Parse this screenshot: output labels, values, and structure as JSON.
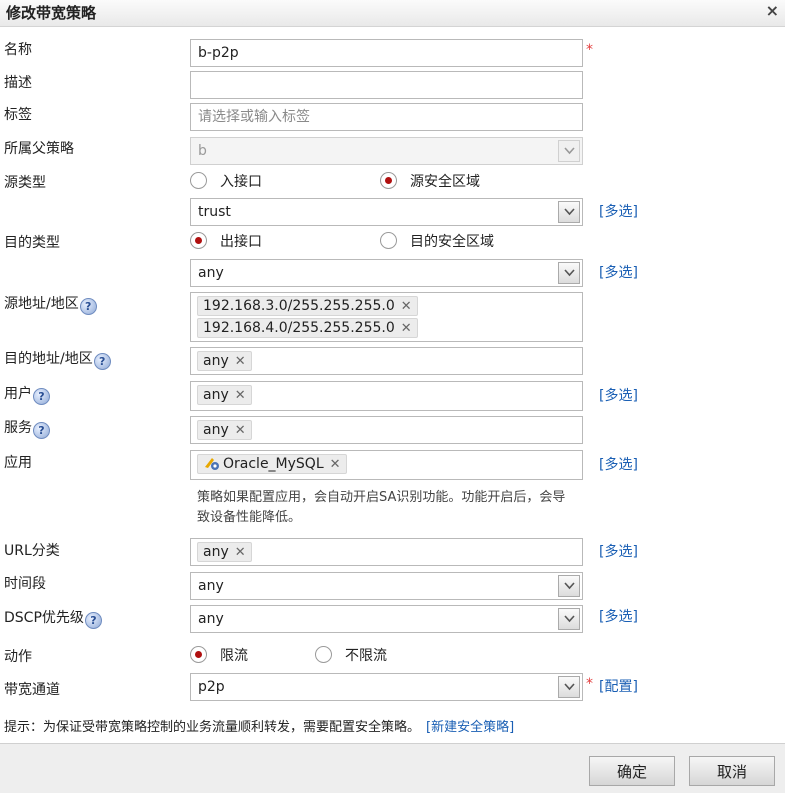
{
  "dialog": {
    "title": "修改带宽策略",
    "close": "×"
  },
  "fields": {
    "name": {
      "label": "名称",
      "value": "b-p2p",
      "required": "*"
    },
    "desc": {
      "label": "描述",
      "value": ""
    },
    "tags": {
      "label": "标签",
      "placeholder": "请选择或输入标签"
    },
    "parent": {
      "label": "所属父策略",
      "value": "b"
    },
    "src_type": {
      "label": "源类型",
      "opt1": "入接口",
      "opt2": "源安全区域",
      "selected": "源安全区域",
      "zone": "trust",
      "multi": "[多选]"
    },
    "dst_type": {
      "label": "目的类型",
      "opt1": "出接口",
      "opt2": "目的安全区域",
      "selected": "出接口",
      "iface": "any",
      "multi": "[多选]"
    },
    "src_addr": {
      "label": "源地址/地区",
      "tags": [
        "192.168.3.0/255.255.255.0",
        "192.168.4.0/255.255.255.0"
      ]
    },
    "dst_addr": {
      "label": "目的地址/地区",
      "tags": [
        "any"
      ]
    },
    "user": {
      "label": "用户",
      "tags": [
        "any"
      ],
      "multi": "[多选]"
    },
    "service": {
      "label": "服务",
      "tags": [
        "any"
      ]
    },
    "app": {
      "label": "应用",
      "tags": [
        "Oracle_MySQL"
      ],
      "multi": "[多选]",
      "hint": "策略如果配置应用，会自动开启SA识别功能。功能开启后，会导致设备性能降低。"
    },
    "url": {
      "label": "URL分类",
      "tags": [
        "any"
      ],
      "multi": "[多选]"
    },
    "schedule": {
      "label": "时间段",
      "value": "any"
    },
    "dscp": {
      "label": "DSCP优先级",
      "value": "any",
      "multi": "[多选]"
    },
    "action": {
      "label": "动作",
      "opt1": "限流",
      "opt2": "不限流",
      "selected": "限流"
    },
    "channel": {
      "label": "带宽通道",
      "value": "p2p",
      "required": "*",
      "config": "[配置]"
    }
  },
  "tip": {
    "text": "提示：为保证受带宽策略控制的业务流量顺利转发，需要配置安全策略。",
    "link": "[新建安全策略]"
  },
  "buttons": {
    "ok": "确定",
    "cancel": "取消"
  },
  "help_glyph": "?",
  "colors": {
    "link": "#1a5fb4",
    "radio_dot": "#b01010",
    "required": "#e23c3c"
  }
}
